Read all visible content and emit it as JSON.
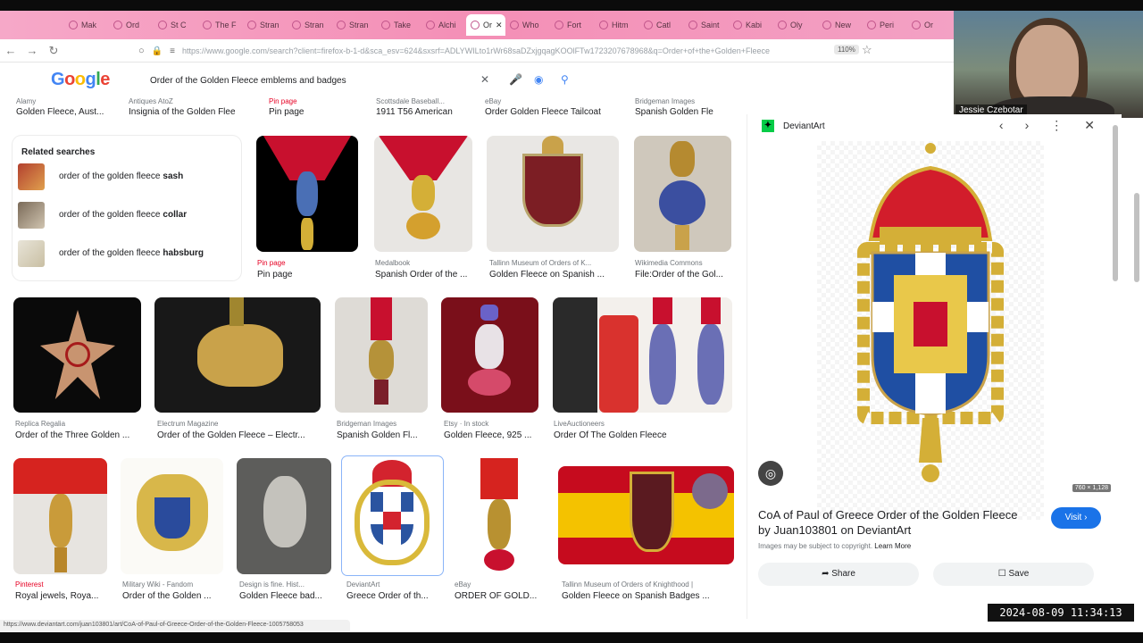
{
  "tabs": [
    {
      "label": "Mak"
    },
    {
      "label": "Ord"
    },
    {
      "label": "St C"
    },
    {
      "label": "The F"
    },
    {
      "label": "Stran"
    },
    {
      "label": "Stran"
    },
    {
      "label": "Stran"
    },
    {
      "label": "Take"
    },
    {
      "label": "Alchi"
    },
    {
      "label": "Or"
    },
    {
      "label": "Who"
    },
    {
      "label": "Fort"
    },
    {
      "label": "Hitm"
    },
    {
      "label": "Catl"
    },
    {
      "label": "Saint"
    },
    {
      "label": "Kabi"
    },
    {
      "label": "Oly"
    },
    {
      "label": "New"
    },
    {
      "label": "Peri"
    },
    {
      "label": "Or"
    }
  ],
  "browser": {
    "url": "https://www.google.com/search?client=firefox-b-1-d&sca_esv=624&sxsrf=ADLYWILto1rWr68saDZxjgqagKOOlFTw1723207678968&q=Order+of+the+Golden+Fleece",
    "zoom": "110%"
  },
  "webcam": {
    "name": "Jessie Czebotar"
  },
  "google": {
    "logo": [
      "G",
      "o",
      "o",
      "g",
      "l",
      "e"
    ],
    "query": "Order of the Golden Fleece emblems and badges"
  },
  "top_row": [
    {
      "source": "Alamy",
      "title": "Golden Fleece, Aust..."
    },
    {
      "source": "Antiques AtoZ",
      "title": "Insignia of the Golden Flee"
    },
    {
      "source": "Pin page",
      "title": "Pin page"
    },
    {
      "source": "Scottsdale Baseball...",
      "title": "1911 T56 American"
    },
    {
      "source": "eBay",
      "title": "Order Golden Fleece Tailcoat"
    },
    {
      "source": "Bridgeman Images",
      "title": "Spanish Golden Fle"
    }
  ],
  "related": {
    "heading": "Related searches",
    "items": [
      {
        "prefix": "order of the golden fleece",
        "bold": "sash"
      },
      {
        "prefix": "order of the golden fleece",
        "bold": "collar"
      },
      {
        "prefix": "order of the golden fleece",
        "bold": "habsburg"
      }
    ]
  },
  "row1": [
    {
      "source": "Pin page",
      "title": "Pin page"
    },
    {
      "source": "Medalbook",
      "title": "Spanish Order of the ..."
    },
    {
      "source": "Tallinn Museum of Orders of K...",
      "title": "Golden Fleece on Spanish ..."
    },
    {
      "source": "Wikimedia Commons",
      "title": "File:Order of the Gol..."
    }
  ],
  "row2": [
    {
      "source": "Replica Regalia",
      "title": "Order of the Three Golden ..."
    },
    {
      "source": "Electrum Magazine",
      "title": "Order of the Golden Fleece – Electr..."
    },
    {
      "source": "Bridgeman Images",
      "title": "Spanish Golden Fl..."
    },
    {
      "source": "Etsy · In stock",
      "title": "Golden Fleece, 925 ..."
    },
    {
      "source": "LiveAuctioneers",
      "title": "Order Of The Golden Fleece"
    }
  ],
  "row3": [
    {
      "source": "Pinterest",
      "title": "Royal jewels, Roya..."
    },
    {
      "source": "Military Wiki - Fandom",
      "title": "Order of the Golden ..."
    },
    {
      "source": "Design is fine. Hist...",
      "title": "Golden Fleece bad..."
    },
    {
      "source": "DeviantArt",
      "title": "Greece Order of th..."
    },
    {
      "source": "eBay",
      "title": "ORDER OF GOLD..."
    },
    {
      "source": "Tallinn Museum of Orders of Knighthood |",
      "title": "Golden Fleece on Spanish Badges ..."
    }
  ],
  "panel": {
    "site": "DeviantArt",
    "dims": "760 × 1,128",
    "title": "CoA of Paul of Greece Order of the Golden Fleece by Juan103801 on DeviantArt",
    "visit": "Visit",
    "copyright": "Images may be subject to copyright.",
    "learn_more": "Learn More",
    "share": "Share",
    "save": "Save"
  },
  "status_url": "https://www.deviantart.com/juan103801/art/CoA-of-Paul-of-Greece-Order-of-the-Golden-Fleece-1005758053",
  "timestamp": "2024-08-09 11:34:13"
}
